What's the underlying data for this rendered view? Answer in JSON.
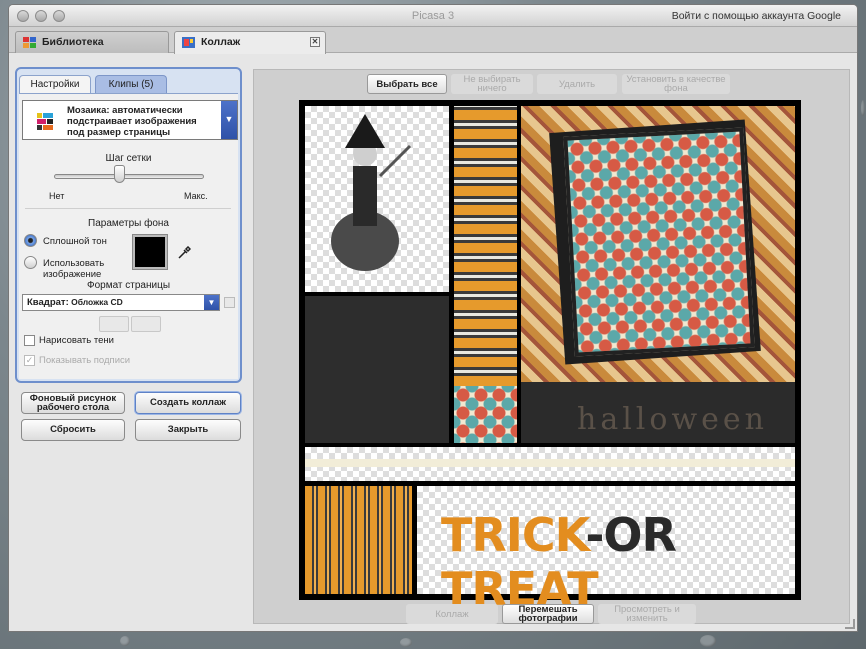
{
  "window": {
    "title": "Picasa 3",
    "account_link": "Войти с помощью аккаунта Google"
  },
  "tabs": [
    {
      "label": "Библиотека"
    },
    {
      "label": "Коллаж"
    }
  ],
  "panel": {
    "tabs": [
      {
        "label": "Настройки"
      },
      {
        "label": "Клипы (5)"
      }
    ],
    "mode": {
      "name": "Мозаика",
      "description": ": автоматически подстраивает изображения под размер страницы"
    },
    "grid": {
      "label": "Шаг сетки",
      "min_label": "Нет",
      "max_label": "Макс.",
      "value": 0.45
    },
    "background": {
      "label": "Параметры фона",
      "solid": "Сплошной тон",
      "image": "Использовать изображение",
      "color": "#000000"
    },
    "page_format": {
      "label": "Формат страницы",
      "value_bold": "Квадрат:",
      "value_rest": " Обложка CD"
    },
    "draw_shadows": "Нарисовать тени",
    "show_captions": "Показывать подписи",
    "buttons": {
      "desktop": "Фоновый рисунок рабочего стола",
      "create": "Создать коллаж",
      "reset": "Сбросить",
      "close": "Закрыть"
    }
  },
  "toolbar": {
    "select_all": "Выбрать все",
    "select_none": "Не выбирать ничего",
    "delete": "Удалить",
    "set_background": "Установить в качестве фона"
  },
  "collage": {
    "halloween_text": "halloween",
    "trick": "TRICK",
    "or": "-OR",
    "treat": "TREAT"
  },
  "bottombar": {
    "collage": "Коллаж",
    "shuffle": "Перемешать фотографии",
    "view_edit": "Просмотреть и изменить"
  }
}
